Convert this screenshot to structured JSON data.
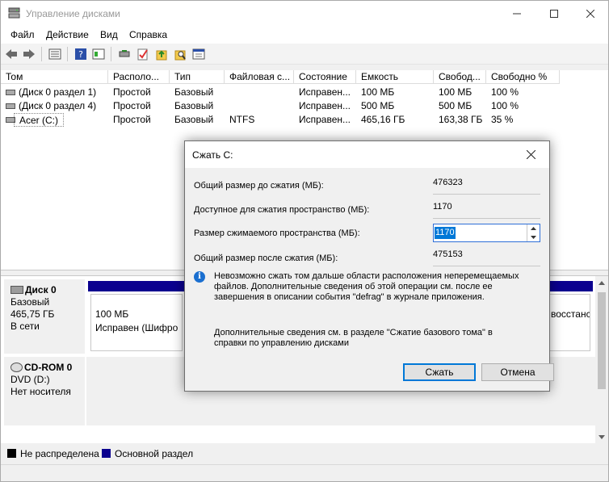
{
  "window": {
    "title": "Управление дисками",
    "icons": {
      "app": "disk-management-icon",
      "minimize": "minimize-icon",
      "maximize": "maximize-icon",
      "close": "close-icon"
    }
  },
  "menu": {
    "items": [
      "Файл",
      "Действие",
      "Вид",
      "Справка"
    ]
  },
  "toolbar": {
    "buttons": [
      "back-icon",
      "forward-icon",
      "volume-list-icon",
      "help-icon",
      "help-book-icon",
      "connect-icon",
      "checkmark-icon",
      "folder-up-icon",
      "folder-search-icon",
      "properties-icon"
    ]
  },
  "volume_list": {
    "columns": [
      "Том",
      "Располо...",
      "Тип",
      "Файловая с...",
      "Состояние",
      "Емкость",
      "Свобод...",
      "Свободно %"
    ],
    "rows": [
      {
        "name": "(Диск 0 раздел 1)",
        "layout": "Простой",
        "type": "Базовый",
        "fs": "",
        "status": "Исправен...",
        "capacity": "100 МБ",
        "free": "100 МБ",
        "free_pct": "100 %"
      },
      {
        "name": "(Диск 0 раздел 4)",
        "layout": "Простой",
        "type": "Базовый",
        "fs": "",
        "status": "Исправен...",
        "capacity": "500 МБ",
        "free": "500 МБ",
        "free_pct": "100 %"
      },
      {
        "name": "Acer (C:)",
        "layout": "Простой",
        "type": "Базовый",
        "fs": "NTFS",
        "status": "Исправен...",
        "capacity": "465,16 ГБ",
        "free": "163,38 ГБ",
        "free_pct": "35 %"
      }
    ]
  },
  "disks": [
    {
      "name": "Диск 0",
      "type": "Базовый",
      "size": "465,75 ГБ",
      "status": "В сети",
      "partitions": [
        {
          "size": "100 МБ",
          "status": "Исправен (Шифро"
        },
        {
          "size": "",
          "status": "восстанс"
        }
      ]
    },
    {
      "name": "CD-ROM 0",
      "type": "DVD (D:)",
      "size": "",
      "status": "Нет носителя"
    }
  ],
  "legend": [
    {
      "label": "Не распределена",
      "color": "#000000"
    },
    {
      "label": "Основной раздел",
      "color": "#0b008f"
    }
  ],
  "dialog": {
    "title": "Сжать C:",
    "fields": [
      {
        "label": "Общий размер до сжатия (МБ):",
        "value": "476323"
      },
      {
        "label": "Доступное для сжатия пространство (МБ):",
        "value": "1170"
      },
      {
        "label": "Размер сжимаемого пространства (МБ):",
        "value": "1170"
      },
      {
        "label": "Общий размер после сжатия (МБ):",
        "value": "475153"
      }
    ],
    "info_text": "Невозможно сжать том дальше области расположения неперемещаемых файлов. Дополнительные сведения об этой операции см. после ее завершения в описании события \"defrag\" в журнале приложения.",
    "help_text": "Дополнительные сведения см. в разделе \"Сжатие базового тома\" в справки по управлению дисками",
    "shrink_button": "Сжать",
    "cancel_button": "Отмена",
    "accent": "#0078d7"
  }
}
